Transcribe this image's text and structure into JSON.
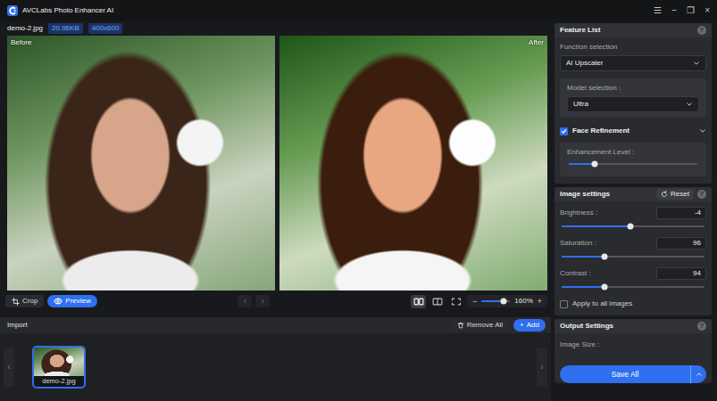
{
  "window": {
    "title": "AVCLabs Photo Enhancer AI",
    "controls": [
      "☰",
      "−",
      "❐",
      "×"
    ]
  },
  "file": {
    "name": "demo-2.jpg",
    "size": "20.96KB",
    "dimensions": "400x600"
  },
  "compare": {
    "before": "Before",
    "after": "After"
  },
  "toolbar": {
    "crop": {
      "label": "Crop",
      "selected": false
    },
    "preview": {
      "label": "Preview",
      "selected": true
    },
    "prev": {
      "label": "‹",
      "disabled": true
    },
    "next": {
      "label": "›",
      "disabled": true
    },
    "views": [
      {
        "kind": "split",
        "selected": true
      },
      {
        "kind": "compare",
        "selected": false
      },
      {
        "kind": "fit",
        "selected": false
      }
    ],
    "zoom": {
      "minus": "−",
      "plus": "+",
      "reading": "160%",
      "level": 0.78
    }
  },
  "import": {
    "title": "Import",
    "remove": "Remove All",
    "add_icon": "+",
    "add": "Add"
  },
  "thumbnails": {
    "prev": "‹",
    "next": "›",
    "items": [
      {
        "label": "demo-2.jpg",
        "selected": true
      }
    ]
  },
  "feature_list": {
    "title": "Feature List",
    "info": "?",
    "function_label": "Function selection",
    "function_value": "AI Upscaler",
    "model_label": "Model selection :",
    "model_value": "Ultra",
    "face": {
      "label": "Face Refinement",
      "checked": true,
      "expanded": true
    },
    "enhancement_label": "Enhancement Level :",
    "enhancement_level": 0.2
  },
  "image_settings": {
    "title": "Image settings",
    "reset": "Reset",
    "info": "?",
    "sliders": [
      {
        "name": "Brightness :",
        "reading": "-4",
        "level": 0.48
      },
      {
        "name": "Saturation :",
        "reading": "96",
        "level": 0.3
      },
      {
        "name": "Contrast :",
        "reading": "94",
        "level": 0.3
      }
    ],
    "apply": {
      "label": "Apply to all images",
      "checked": false
    }
  },
  "output": {
    "title": "Output Settings",
    "info": "?",
    "image_size": "Image Size :"
  },
  "save": {
    "label": "Save All"
  }
}
